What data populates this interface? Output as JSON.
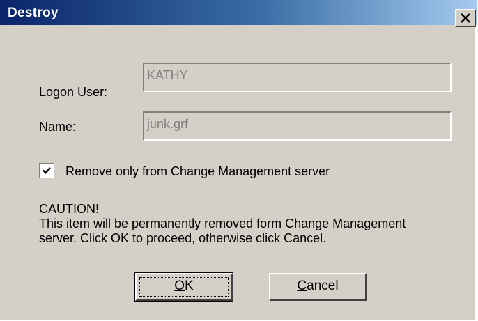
{
  "window": {
    "title": "Destroy",
    "close_icon": "close-icon"
  },
  "form": {
    "logon_user_label": "Logon User:",
    "logon_user_value": "KATHY",
    "name_label": "Name:",
    "name_value": "junk.grf"
  },
  "option": {
    "checked": true,
    "label": "Remove only from Change Management server"
  },
  "message": {
    "heading": "CAUTION!",
    "line1": "This item will be permanently removed form Change Management",
    "line2": "server. Click OK to proceed, otherwise click Cancel."
  },
  "buttons": {
    "ok": {
      "mnemonic": "O",
      "rest": "K"
    },
    "cancel": {
      "mnemonic": "C",
      "rest": "ancel"
    }
  },
  "colors": {
    "dialog_face": "#d4d0c8",
    "title_start": "#0a246a",
    "title_end": "#a6caf0",
    "disabled_text": "#808080"
  }
}
